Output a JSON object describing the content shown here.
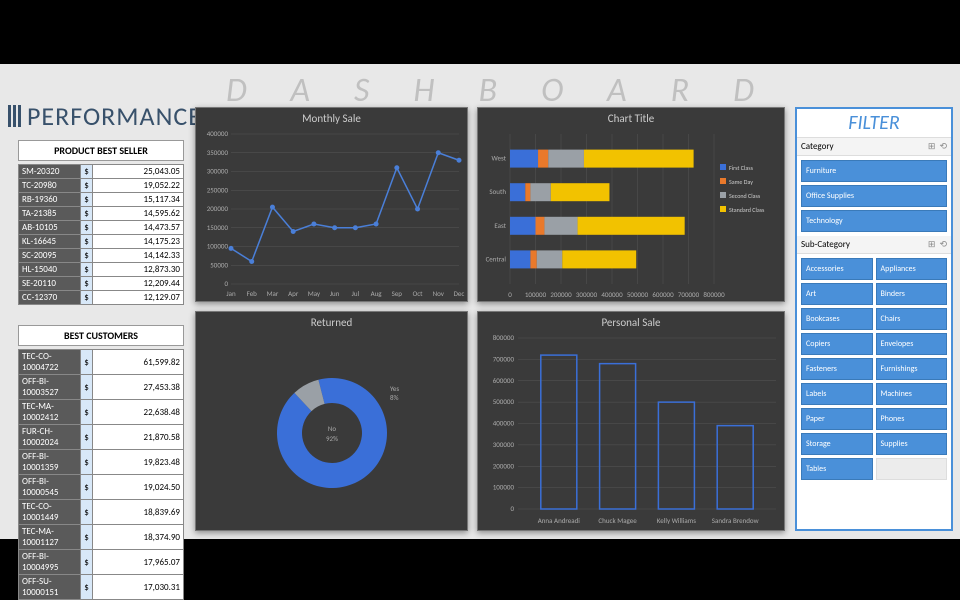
{
  "titles": {
    "dashboard": "DASHBOARD",
    "performance": "PERFORMANCE",
    "filter": "FILTER"
  },
  "tables": {
    "best_seller": {
      "header": "PRODUCT BEST SELLER",
      "currency": "$",
      "rows": [
        {
          "k": "SM-20320",
          "v": "25,043.05"
        },
        {
          "k": "TC-20980",
          "v": "19,052.22"
        },
        {
          "k": "RB-19360",
          "v": "15,117.34"
        },
        {
          "k": "TA-21385",
          "v": "14,595.62"
        },
        {
          "k": "AB-10105",
          "v": "14,473.57"
        },
        {
          "k": "KL-16645",
          "v": "14,175.23"
        },
        {
          "k": "SC-20095",
          "v": "14,142.33"
        },
        {
          "k": "HL-15040",
          "v": "12,873.30"
        },
        {
          "k": "SE-20110",
          "v": "12,209.44"
        },
        {
          "k": "CC-12370",
          "v": "12,129.07"
        }
      ]
    },
    "best_customers": {
      "header": "BEST CUSTOMERS",
      "currency": "$",
      "rows": [
        {
          "k": "TEC-CO-10004722",
          "v": "61,599.82"
        },
        {
          "k": "OFF-BI-10003527",
          "v": "27,453.38"
        },
        {
          "k": "TEC-MA-10002412",
          "v": "22,638.48"
        },
        {
          "k": "FUR-CH-10002024",
          "v": "21,870.58"
        },
        {
          "k": "OFF-BI-10001359",
          "v": "19,823.48"
        },
        {
          "k": "OFF-BI-10000545",
          "v": "19,024.50"
        },
        {
          "k": "TEC-CO-10001449",
          "v": "18,839.69"
        },
        {
          "k": "TEC-MA-10001127",
          "v": "18,374.90"
        },
        {
          "k": "OFF-BI-10004995",
          "v": "17,965.07"
        },
        {
          "k": "OFF-SU-10000151",
          "v": "17,030.31"
        }
      ]
    }
  },
  "filter": {
    "category": {
      "header": "Category",
      "items": [
        "Furniture",
        "Office Supplies",
        "Technology"
      ]
    },
    "subcategory": {
      "header": "Sub-Category",
      "items": [
        "Accessories",
        "Appliances",
        "Art",
        "Binders",
        "Bookcases",
        "Chairs",
        "Copiers",
        "Envelopes",
        "Fasteners",
        "Furnishings",
        "Labels",
        "Machines",
        "Paper",
        "Phones",
        "Storage",
        "Supplies",
        "Tables",
        ""
      ]
    }
  },
  "chart_data": [
    {
      "id": "monthly",
      "type": "line",
      "title": "Monthly Sale",
      "categories": [
        "Jan",
        "Feb",
        "Mar",
        "Apr",
        "May",
        "Jun",
        "Jul",
        "Aug",
        "Sep",
        "Oct",
        "Nov",
        "Dec"
      ],
      "values": [
        95000,
        60000,
        205000,
        140000,
        160000,
        150000,
        150000,
        160000,
        310000,
        200000,
        350000,
        330000
      ],
      "ylabel": "",
      "ylim": [
        0,
        400000
      ],
      "yticks": [
        0,
        50000,
        100000,
        150000,
        200000,
        250000,
        300000,
        350000,
        400000
      ]
    },
    {
      "id": "stacked",
      "type": "bar",
      "orientation": "horizontal",
      "stacked": true,
      "title": "Chart Title",
      "categories": [
        "West",
        "South",
        "East",
        "Central"
      ],
      "series": [
        {
          "name": "First Class",
          "color": "#3a6fd8",
          "values": [
            110000,
            60000,
            100000,
            80000
          ]
        },
        {
          "name": "Same Day",
          "color": "#e9792b",
          "values": [
            40000,
            20000,
            35000,
            25000
          ]
        },
        {
          "name": "Second Class",
          "color": "#9aa0a6",
          "values": [
            140000,
            80000,
            130000,
            100000
          ]
        },
        {
          "name": "Standard Class",
          "color": "#f2c200",
          "values": [
            430000,
            230000,
            420000,
            290000
          ]
        }
      ],
      "xlim": [
        0,
        800000
      ],
      "xticks": [
        0,
        100000,
        200000,
        300000,
        400000,
        500000,
        600000,
        700000,
        800000
      ]
    },
    {
      "id": "returned",
      "type": "pie",
      "subtype": "doughnut",
      "title": "Returned",
      "slices": [
        {
          "name": "No",
          "value": 92,
          "color": "#3a6fd8"
        },
        {
          "name": "Yes",
          "value": 8,
          "color": "#9aa0a6"
        }
      ],
      "center_label": "No\n92%",
      "callout": "Yes\n8%"
    },
    {
      "id": "personal",
      "type": "bar",
      "title": "Personal Sale",
      "categories": [
        "Anna Andreadi",
        "Chuck Magee",
        "Kelly Williams",
        "Sandra Brendow"
      ],
      "values": [
        720000,
        680000,
        500000,
        390000
      ],
      "ylim": [
        0,
        800000
      ],
      "yticks": [
        0,
        100000,
        200000,
        300000,
        400000,
        500000,
        600000,
        700000,
        800000
      ],
      "color": "#3a6fd8",
      "fill": "none"
    }
  ]
}
